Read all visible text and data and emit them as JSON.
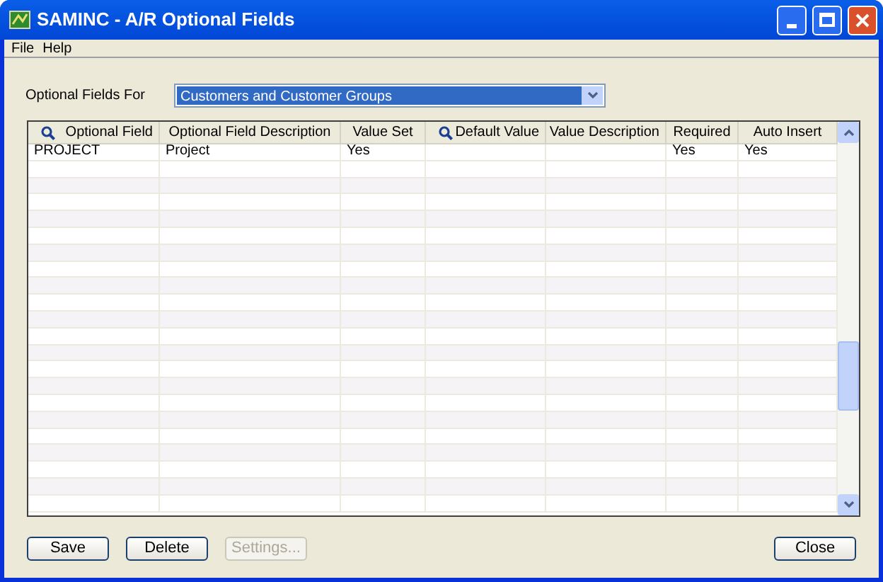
{
  "window": {
    "title": "SAMINC - A/R Optional Fields"
  },
  "menu": [
    {
      "label": "File"
    },
    {
      "label": "Help"
    }
  ],
  "optional_fields_for": {
    "label": "Optional Fields For",
    "value": "Customers and Customer Groups"
  },
  "table": {
    "columns": [
      {
        "label": "Optional Field",
        "search": true
      },
      {
        "label": "Optional Field Description",
        "search": false
      },
      {
        "label": "Value Set",
        "search": false
      },
      {
        "label": "Default Value",
        "search": true
      },
      {
        "label": "Value Description",
        "search": false
      },
      {
        "label": "Required",
        "search": false
      },
      {
        "label": "Auto Insert",
        "search": false
      }
    ],
    "rows": [
      [
        "PROJECT",
        "Project",
        "Yes",
        "",
        "",
        "Yes",
        "Yes"
      ]
    ]
  },
  "buttons": [
    {
      "label": "Save",
      "disabled": false
    },
    {
      "label": "Delete",
      "disabled": false
    },
    {
      "label": "Settings...",
      "disabled": true
    },
    {
      "label": "Close",
      "disabled": false
    }
  ]
}
